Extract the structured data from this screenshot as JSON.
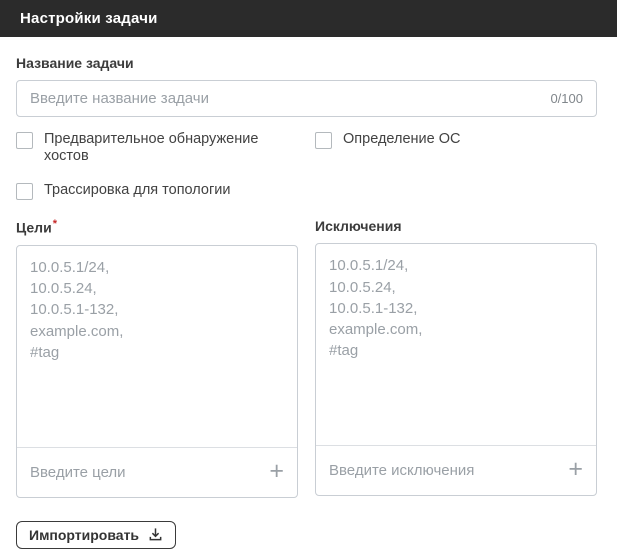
{
  "header": {
    "title": "Настройки задачи"
  },
  "name_field": {
    "label": "Название задачи",
    "value": "",
    "placeholder": "Введите название задачи",
    "counter": "0/100"
  },
  "checkboxes": [
    {
      "label": "Предварительное обнаружение хостов",
      "checked": false
    },
    {
      "label": "Определение ОС",
      "checked": false
    },
    {
      "label": "Трассировка для топологии",
      "checked": false
    }
  ],
  "targets": {
    "label": "Цели",
    "required_mark": "*",
    "value": "",
    "placeholder": "10.0.5.1/24,\n10.0.5.24,\n10.0.5.1-132,\nexample.com,\n#tag",
    "add_placeholder": "Введите цели"
  },
  "exclusions": {
    "label": "Исключения",
    "value": "",
    "placeholder": "10.0.5.1/24,\n10.0.5.24,\n10.0.5.1-132,\nexample.com,\n#tag",
    "add_placeholder": "Введите исключения"
  },
  "icons": {
    "plus": "+"
  },
  "import_button": {
    "label": "Импортировать"
  },
  "colors": {
    "header_bg": "#2b2b2b",
    "header_text": "#ffffff",
    "border": "#c9ced4",
    "placeholder": "#9aa0a6",
    "required": "#c62828",
    "button_border": "#3a3a3a"
  }
}
